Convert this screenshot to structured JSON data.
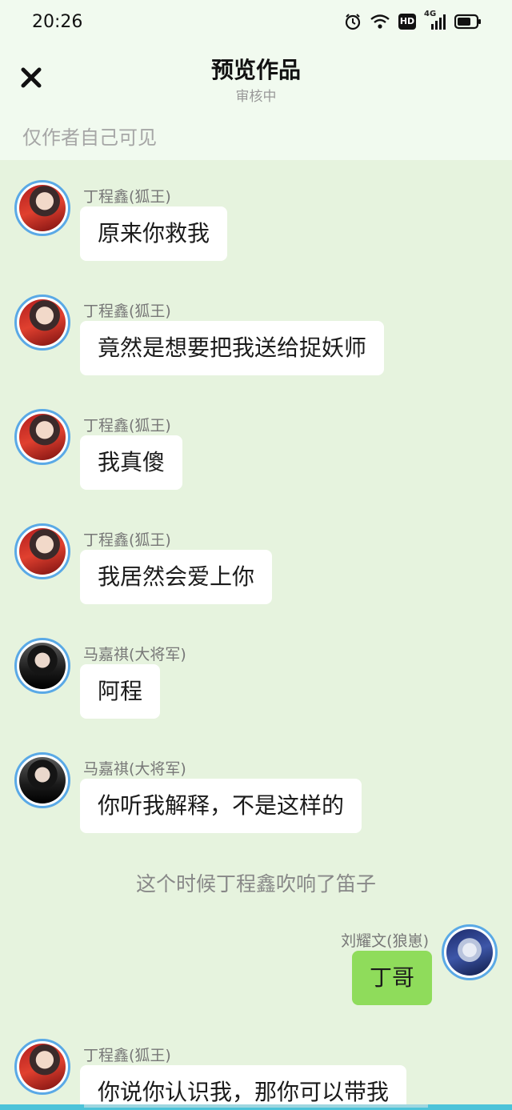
{
  "status_bar": {
    "time": "20:26",
    "icons": [
      "alarm-icon",
      "wifi-icon",
      "hd-icon",
      "4g-signal-icon",
      "battery-icon"
    ],
    "network_label": "4G",
    "hd_label": "HD"
  },
  "header": {
    "title": "预览作品",
    "subtitle": "审核中",
    "close_icon": "close-icon",
    "visibility_note": "仅作者自己可见"
  },
  "messages": [
    {
      "side": "left",
      "name": "丁程鑫(狐王)",
      "avatar": "ding",
      "text": "原来你救我"
    },
    {
      "side": "left",
      "name": "丁程鑫(狐王)",
      "avatar": "ding",
      "text": "竟然是想要把我送给捉妖师"
    },
    {
      "side": "left",
      "name": "丁程鑫(狐王)",
      "avatar": "ding",
      "text": "我真傻"
    },
    {
      "side": "left",
      "name": "丁程鑫(狐王)",
      "avatar": "ding",
      "text": "我居然会爱上你"
    },
    {
      "side": "left",
      "name": "马嘉祺(大将军)",
      "avatar": "ma",
      "text": "阿程"
    },
    {
      "side": "left",
      "name": "马嘉祺(大将军)",
      "avatar": "ma",
      "text": "你听我解释，不是这样的"
    },
    {
      "side": "center",
      "text": "这个时候丁程鑫吹响了笛子"
    },
    {
      "side": "right",
      "name": "刘耀文(狼崽)",
      "avatar": "liu",
      "text": "丁哥"
    },
    {
      "side": "left",
      "name": "丁程鑫(狐王)",
      "avatar": "ding",
      "text": "你说你认识我，那你可以带我"
    }
  ],
  "colors": {
    "chat_background": "#e6f3de",
    "header_background": "#f1faef",
    "right_bubble": "#8fdc5b",
    "left_bubble": "#ffffff",
    "avatar_ring": "#5aa9e6"
  }
}
